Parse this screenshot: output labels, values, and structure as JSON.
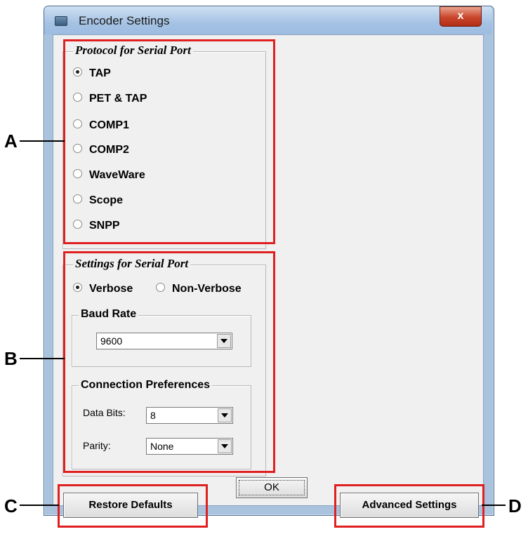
{
  "window": {
    "title": "Encoder Settings",
    "close_label": "x"
  },
  "protocol": {
    "legend": "Protocol for Serial Port",
    "options": [
      "TAP",
      "PET & TAP",
      "COMP1",
      "COMP2",
      "WaveWare",
      "Scope",
      "SNPP"
    ],
    "selected": "TAP"
  },
  "settings": {
    "legend": "Settings for Serial Port",
    "verbose_label": "Verbose",
    "nonverbose_label": "Non-Verbose",
    "selected": "Verbose",
    "baud": {
      "legend": "Baud Rate",
      "value": "9600"
    },
    "connection": {
      "legend": "Connection Preferences",
      "data_bits_label": "Data Bits:",
      "data_bits_value": "8",
      "parity_label": "Parity:",
      "parity_value": "None"
    }
  },
  "buttons": {
    "restore": "Restore Defaults",
    "ok": "OK",
    "advanced": "Advanced Settings"
  },
  "callouts": {
    "a": "A",
    "b": "B",
    "c": "C",
    "d": "D"
  },
  "colors": {
    "annotation": "#e02020",
    "titlebar": "#a5c2e4",
    "close": "#c9452b"
  }
}
